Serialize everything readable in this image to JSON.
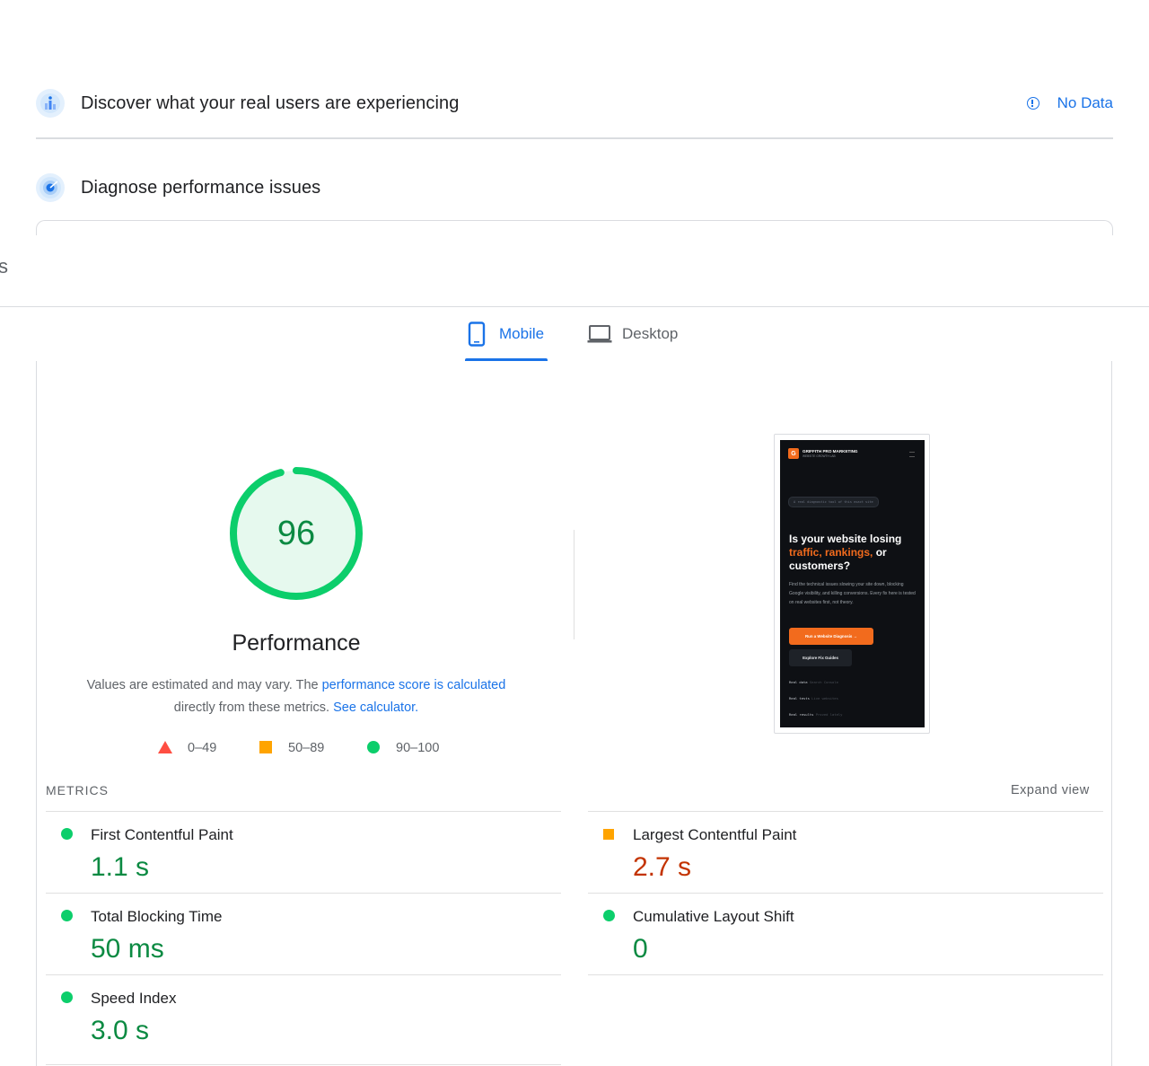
{
  "sections": {
    "real_users": {
      "title": "Discover what your real users are experiencing",
      "status": "No Data"
    },
    "diagnose": {
      "title": "Diagnose performance issues"
    }
  },
  "left_edge_char": "s",
  "tabs": [
    {
      "label": "Mobile",
      "active": true
    },
    {
      "label": "Desktop",
      "active": false
    }
  ],
  "score": {
    "value": "96",
    "value_number": 96,
    "label": "Performance",
    "description_prefix": "Values are estimated and may vary. The ",
    "description_link": "performance score is calculated",
    "description_mid": "directly from these metrics.",
    "calculator_link": "See calculator."
  },
  "legend": [
    {
      "range": "0–49",
      "shape": "triangle",
      "color": "#ff4e42"
    },
    {
      "range": "50–89",
      "shape": "square",
      "color": "#ffa400"
    },
    {
      "range": "90–100",
      "shape": "circle",
      "color": "#0cce6b"
    }
  ],
  "metrics_header": "METRICS",
  "expand_view": "Expand view",
  "metrics": {
    "fcp": {
      "label": "First Contentful Paint",
      "value": "1.1 s",
      "rating": "good"
    },
    "lcp": {
      "label": "Largest Contentful Paint",
      "value": "2.7 s",
      "rating": "average"
    },
    "tbt": {
      "label": "Total Blocking Time",
      "value": "50 ms",
      "rating": "good"
    },
    "cls": {
      "label": "Cumulative Layout Shift",
      "value": "0",
      "rating": "good"
    },
    "si": {
      "label": "Speed Index",
      "value": "3.0 s",
      "rating": "good"
    }
  },
  "phone": {
    "brand": "GRIFFITH PRO MARKETING",
    "brand_sub": "WEBSITE GROWTH LAB",
    "pill": "A real diagnostic tool of this exact site",
    "headline_1": "Is your website losing",
    "headline_accent": "traffic, rankings,",
    "headline_2": " or",
    "headline_3": "customers?",
    "body": "Find the technical issues slowing your site down, blocking Google visibility, and killing conversions. Every fix here is tested on real websites first, not theory.",
    "cta_primary": "Run a Website Diagnosis →",
    "cta_secondary": "Explore Fix Guides",
    "foot_1_a": "Real data",
    "foot_1_b": "Search Console",
    "foot_2_a": "Real tests",
    "foot_2_b": "Live websites",
    "foot_3_a": "Real results",
    "foot_3_b": "Proved lately"
  },
  "colors": {
    "accent_blue": "#1a73e8",
    "good": "#0cce6b",
    "good_text": "#0b8a42",
    "average": "#ffa400",
    "average_text": "#c33300",
    "poor": "#ff4e42",
    "phone_accent": "#f26b1d"
  }
}
